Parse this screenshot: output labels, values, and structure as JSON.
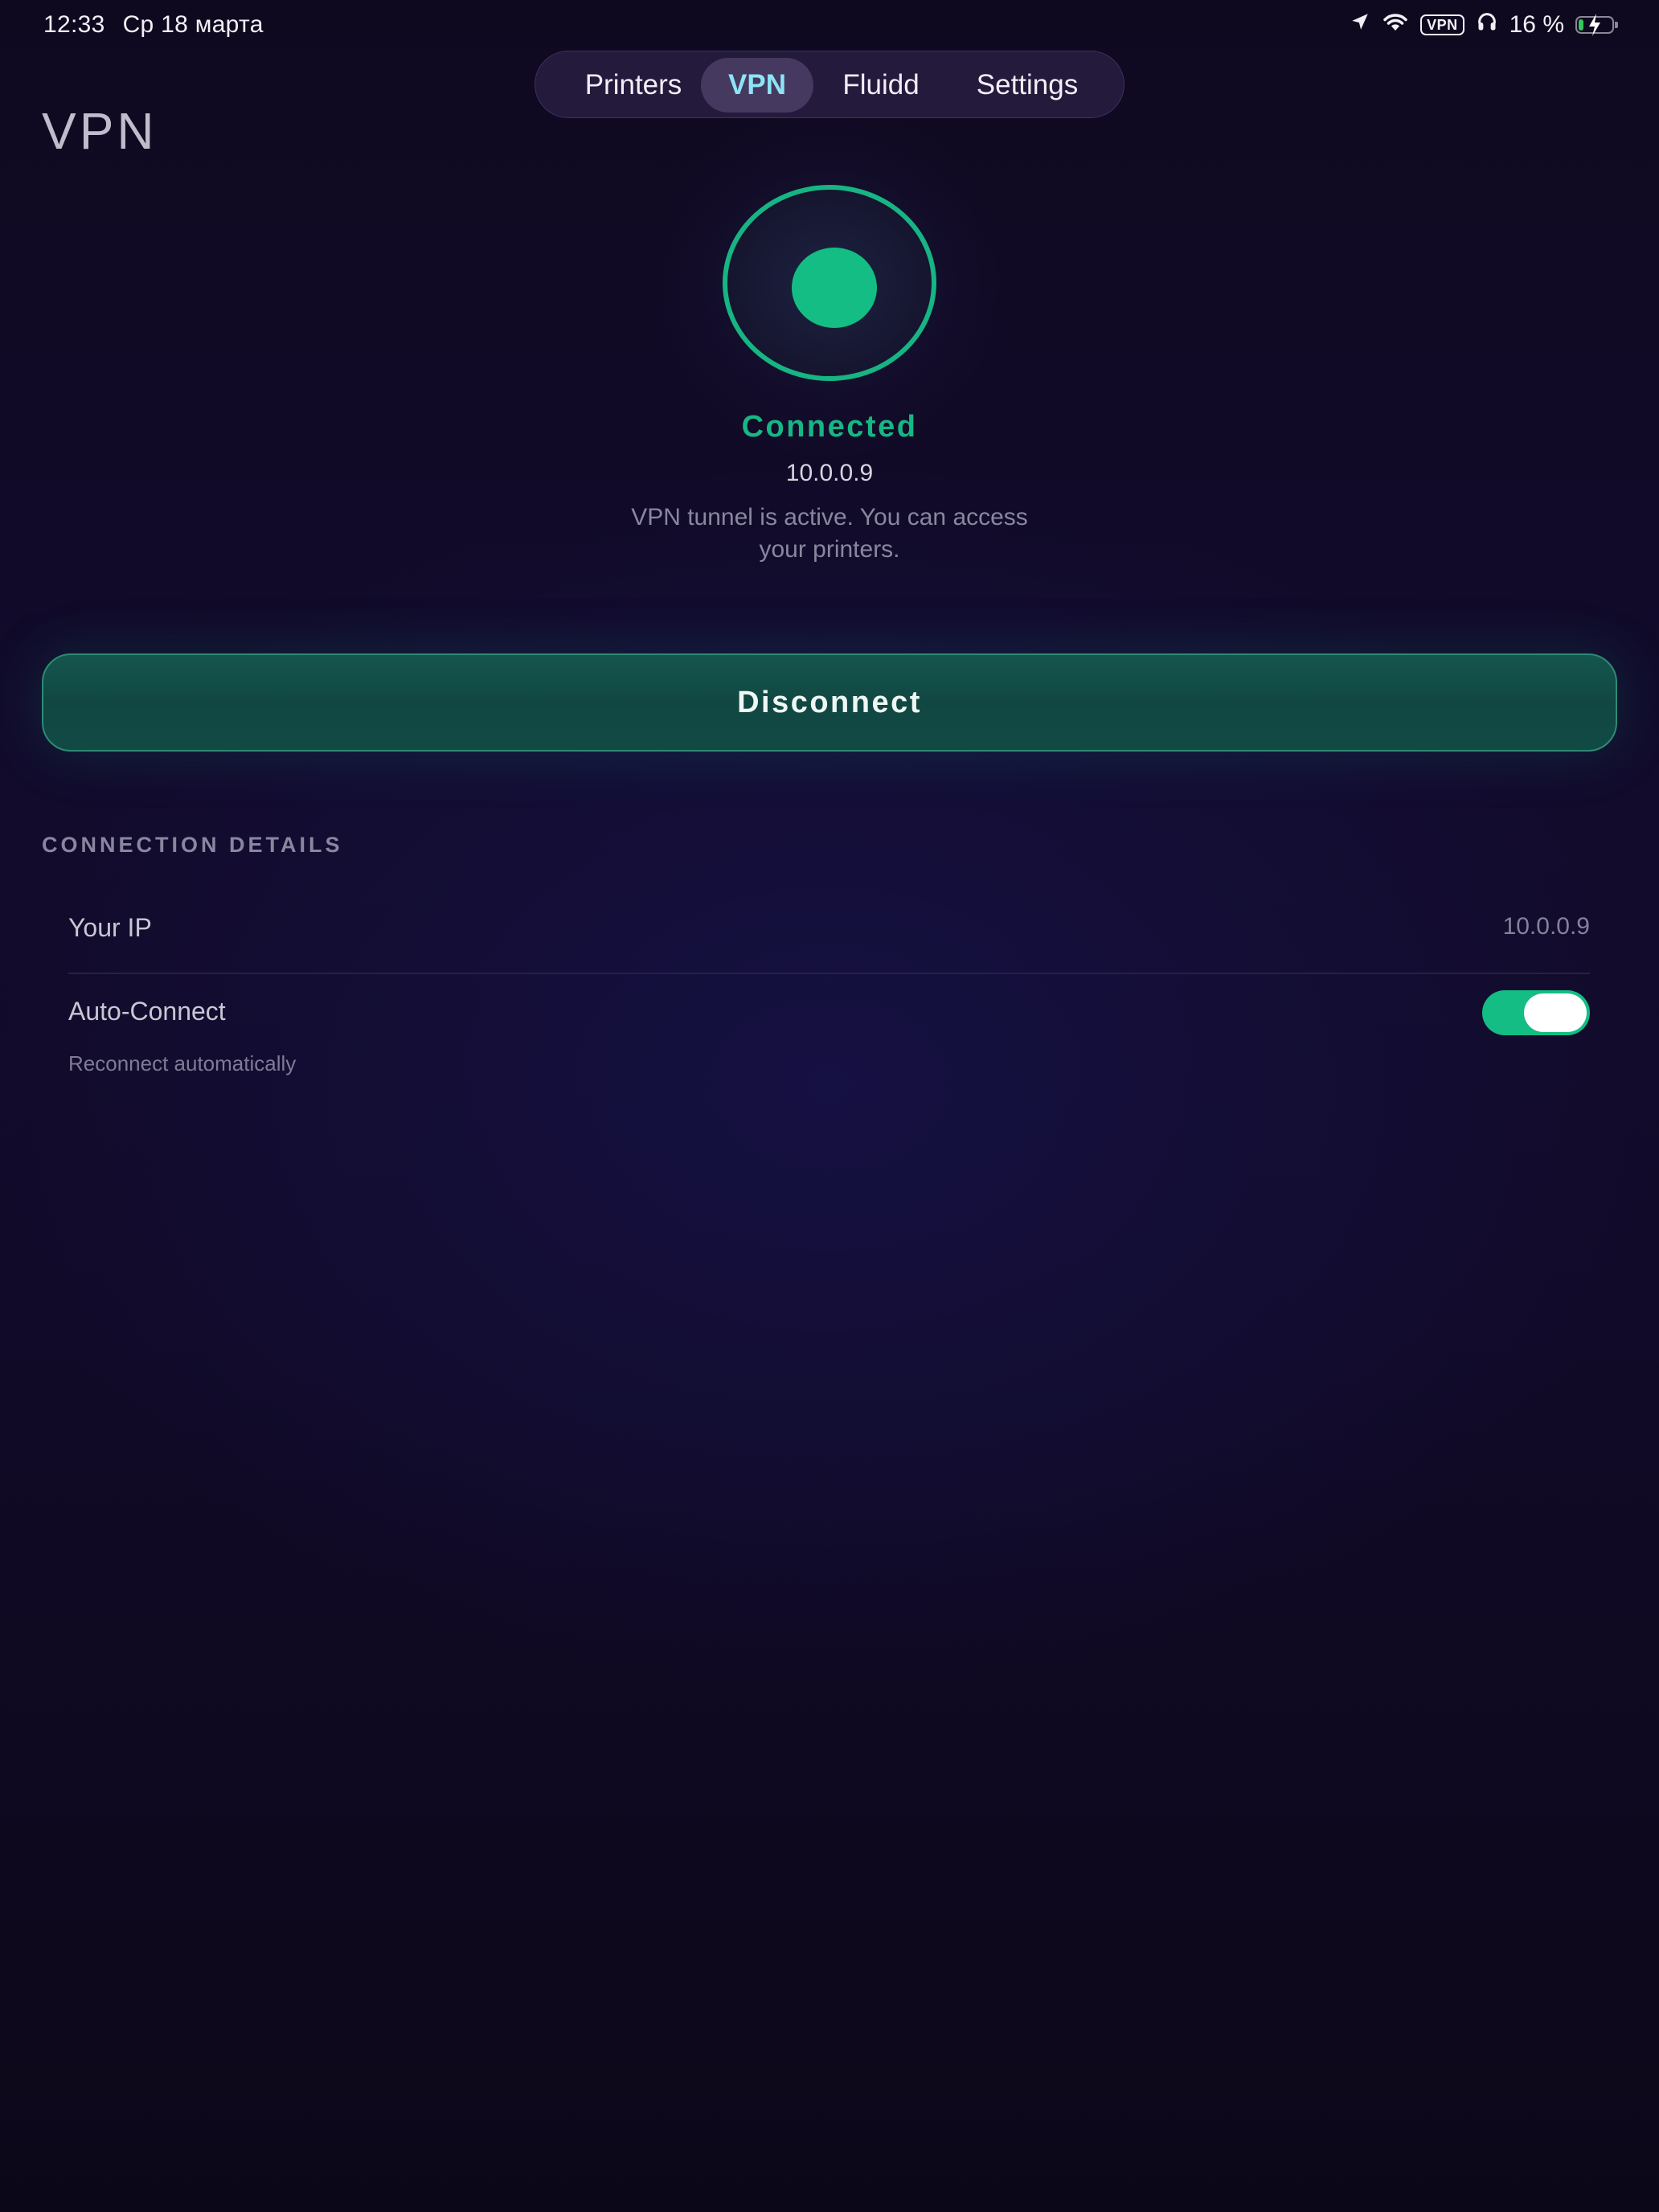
{
  "status_bar": {
    "time": "12:33",
    "date": "Ср 18 марта",
    "vpn_badge": "VPN",
    "battery": "16 %",
    "battery_level": 0.16,
    "icons": [
      "location-arrow-icon",
      "wifi-icon",
      "vpn-badge",
      "headphones-icon",
      "battery-charging-icon"
    ]
  },
  "tabs": [
    {
      "label": "Printers",
      "active": false
    },
    {
      "label": "VPN",
      "active": true
    },
    {
      "label": "Fluidd",
      "active": false
    },
    {
      "label": "Settings",
      "active": false
    }
  ],
  "page": {
    "title": "VPN"
  },
  "vpn_status": {
    "state": "Connected",
    "ip": "10.0.0.9",
    "description": "VPN tunnel is active. You can access your printers.",
    "indicator_icon": "status-ring-icon"
  },
  "actions": {
    "disconnect_label": "Disconnect"
  },
  "connection_details": {
    "header": "CONNECTION DETAILS",
    "your_ip_label": "Your IP",
    "your_ip_value": "10.0.0.9",
    "auto_connect_label": "Auto-Connect",
    "auto_connect_sub": "Reconnect automatically",
    "auto_connect_enabled": true
  },
  "colors": {
    "accent_green": "#13bd84",
    "active_tab_text": "#8ee3f5",
    "button_bg": "#114742",
    "background": "#110a28"
  }
}
